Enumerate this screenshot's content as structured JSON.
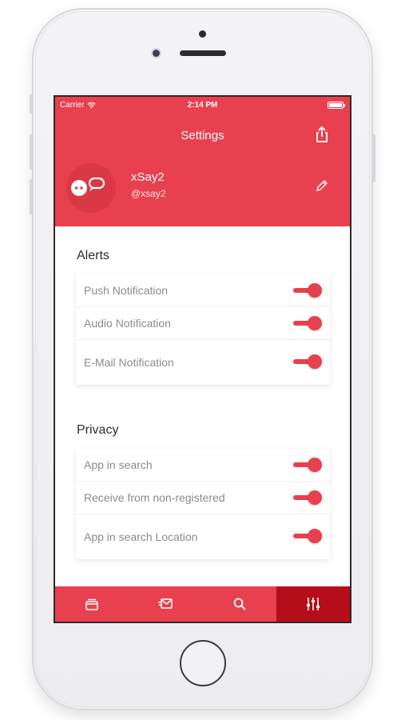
{
  "status_bar": {
    "carrier": "Carrier",
    "time": "2:14 PM"
  },
  "nav": {
    "title": "Settings"
  },
  "profile": {
    "name": "xSay2",
    "handle": "@xsay2"
  },
  "sections": [
    {
      "title": "Alerts",
      "items": [
        {
          "label": "Push Notification",
          "on": true
        },
        {
          "label": "Audio Notification",
          "on": true
        },
        {
          "label": "E-Mail Notification",
          "on": true
        }
      ]
    },
    {
      "title": "Privacy",
      "items": [
        {
          "label": "App in search",
          "on": true
        },
        {
          "label": "Receive from non-registered",
          "on": true
        },
        {
          "label": "App in search Location",
          "on": true
        }
      ]
    }
  ],
  "tabs": [
    {
      "icon": "inbox-icon",
      "active": false
    },
    {
      "icon": "send-message-icon",
      "active": false
    },
    {
      "icon": "search-icon",
      "active": false
    },
    {
      "icon": "sliders-icon",
      "active": true
    }
  ],
  "colors": {
    "accent": "#e8404f",
    "active_tab": "#b60d1a",
    "label_gray": "#8b8b92"
  }
}
